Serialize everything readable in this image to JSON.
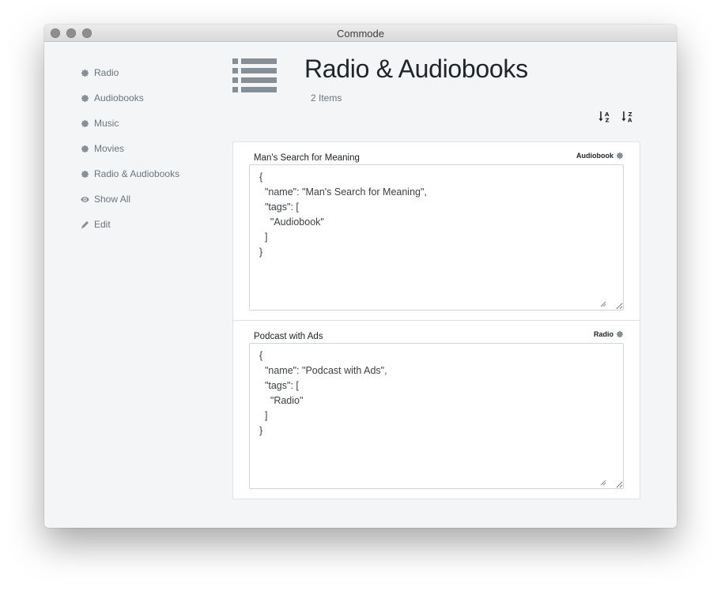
{
  "window": {
    "title": "Commode"
  },
  "sidebar": {
    "items": [
      {
        "label": "Radio",
        "icon": "gear-icon"
      },
      {
        "label": "Audiobooks",
        "icon": "gear-icon"
      },
      {
        "label": "Music",
        "icon": "gear-icon"
      },
      {
        "label": "Movies",
        "icon": "gear-icon"
      },
      {
        "label": "Radio & Audiobooks",
        "icon": "gear-icon"
      },
      {
        "label": "Show All",
        "icon": "eye-icon"
      },
      {
        "label": "Edit",
        "icon": "pencil-icon"
      }
    ]
  },
  "header": {
    "icon": "list-icon",
    "title": "Radio & Audiobooks",
    "count": "2 Items",
    "sort_buttons": [
      {
        "name": "sort-ascending",
        "icon": "sort-alpha-asc-icon",
        "glyph_top": "A",
        "glyph_bottom": "Z"
      },
      {
        "name": "sort-descending",
        "icon": "sort-alpha-desc-icon",
        "glyph_top": "Z",
        "glyph_bottom": "A"
      }
    ]
  },
  "items": [
    {
      "name": "Man's Search for Meaning",
      "tag": "Audiobook",
      "json": "{\n  \"name\": \"Man's Search for Meaning\",\n  \"tags\": [\n    \"Audiobook\"\n  ]\n}"
    },
    {
      "name": "Podcast with Ads",
      "tag": "Radio",
      "json": "{\n  \"name\": \"Podcast with Ads\",\n  \"tags\": [\n    \"Radio\"\n  ]\n}"
    }
  ],
  "colors": {
    "window_bg": "#f4f5f6",
    "text_muted": "#6c757d",
    "text_dark": "#212529",
    "icon_gray": "#868e96",
    "border": "#dfe1e4"
  }
}
